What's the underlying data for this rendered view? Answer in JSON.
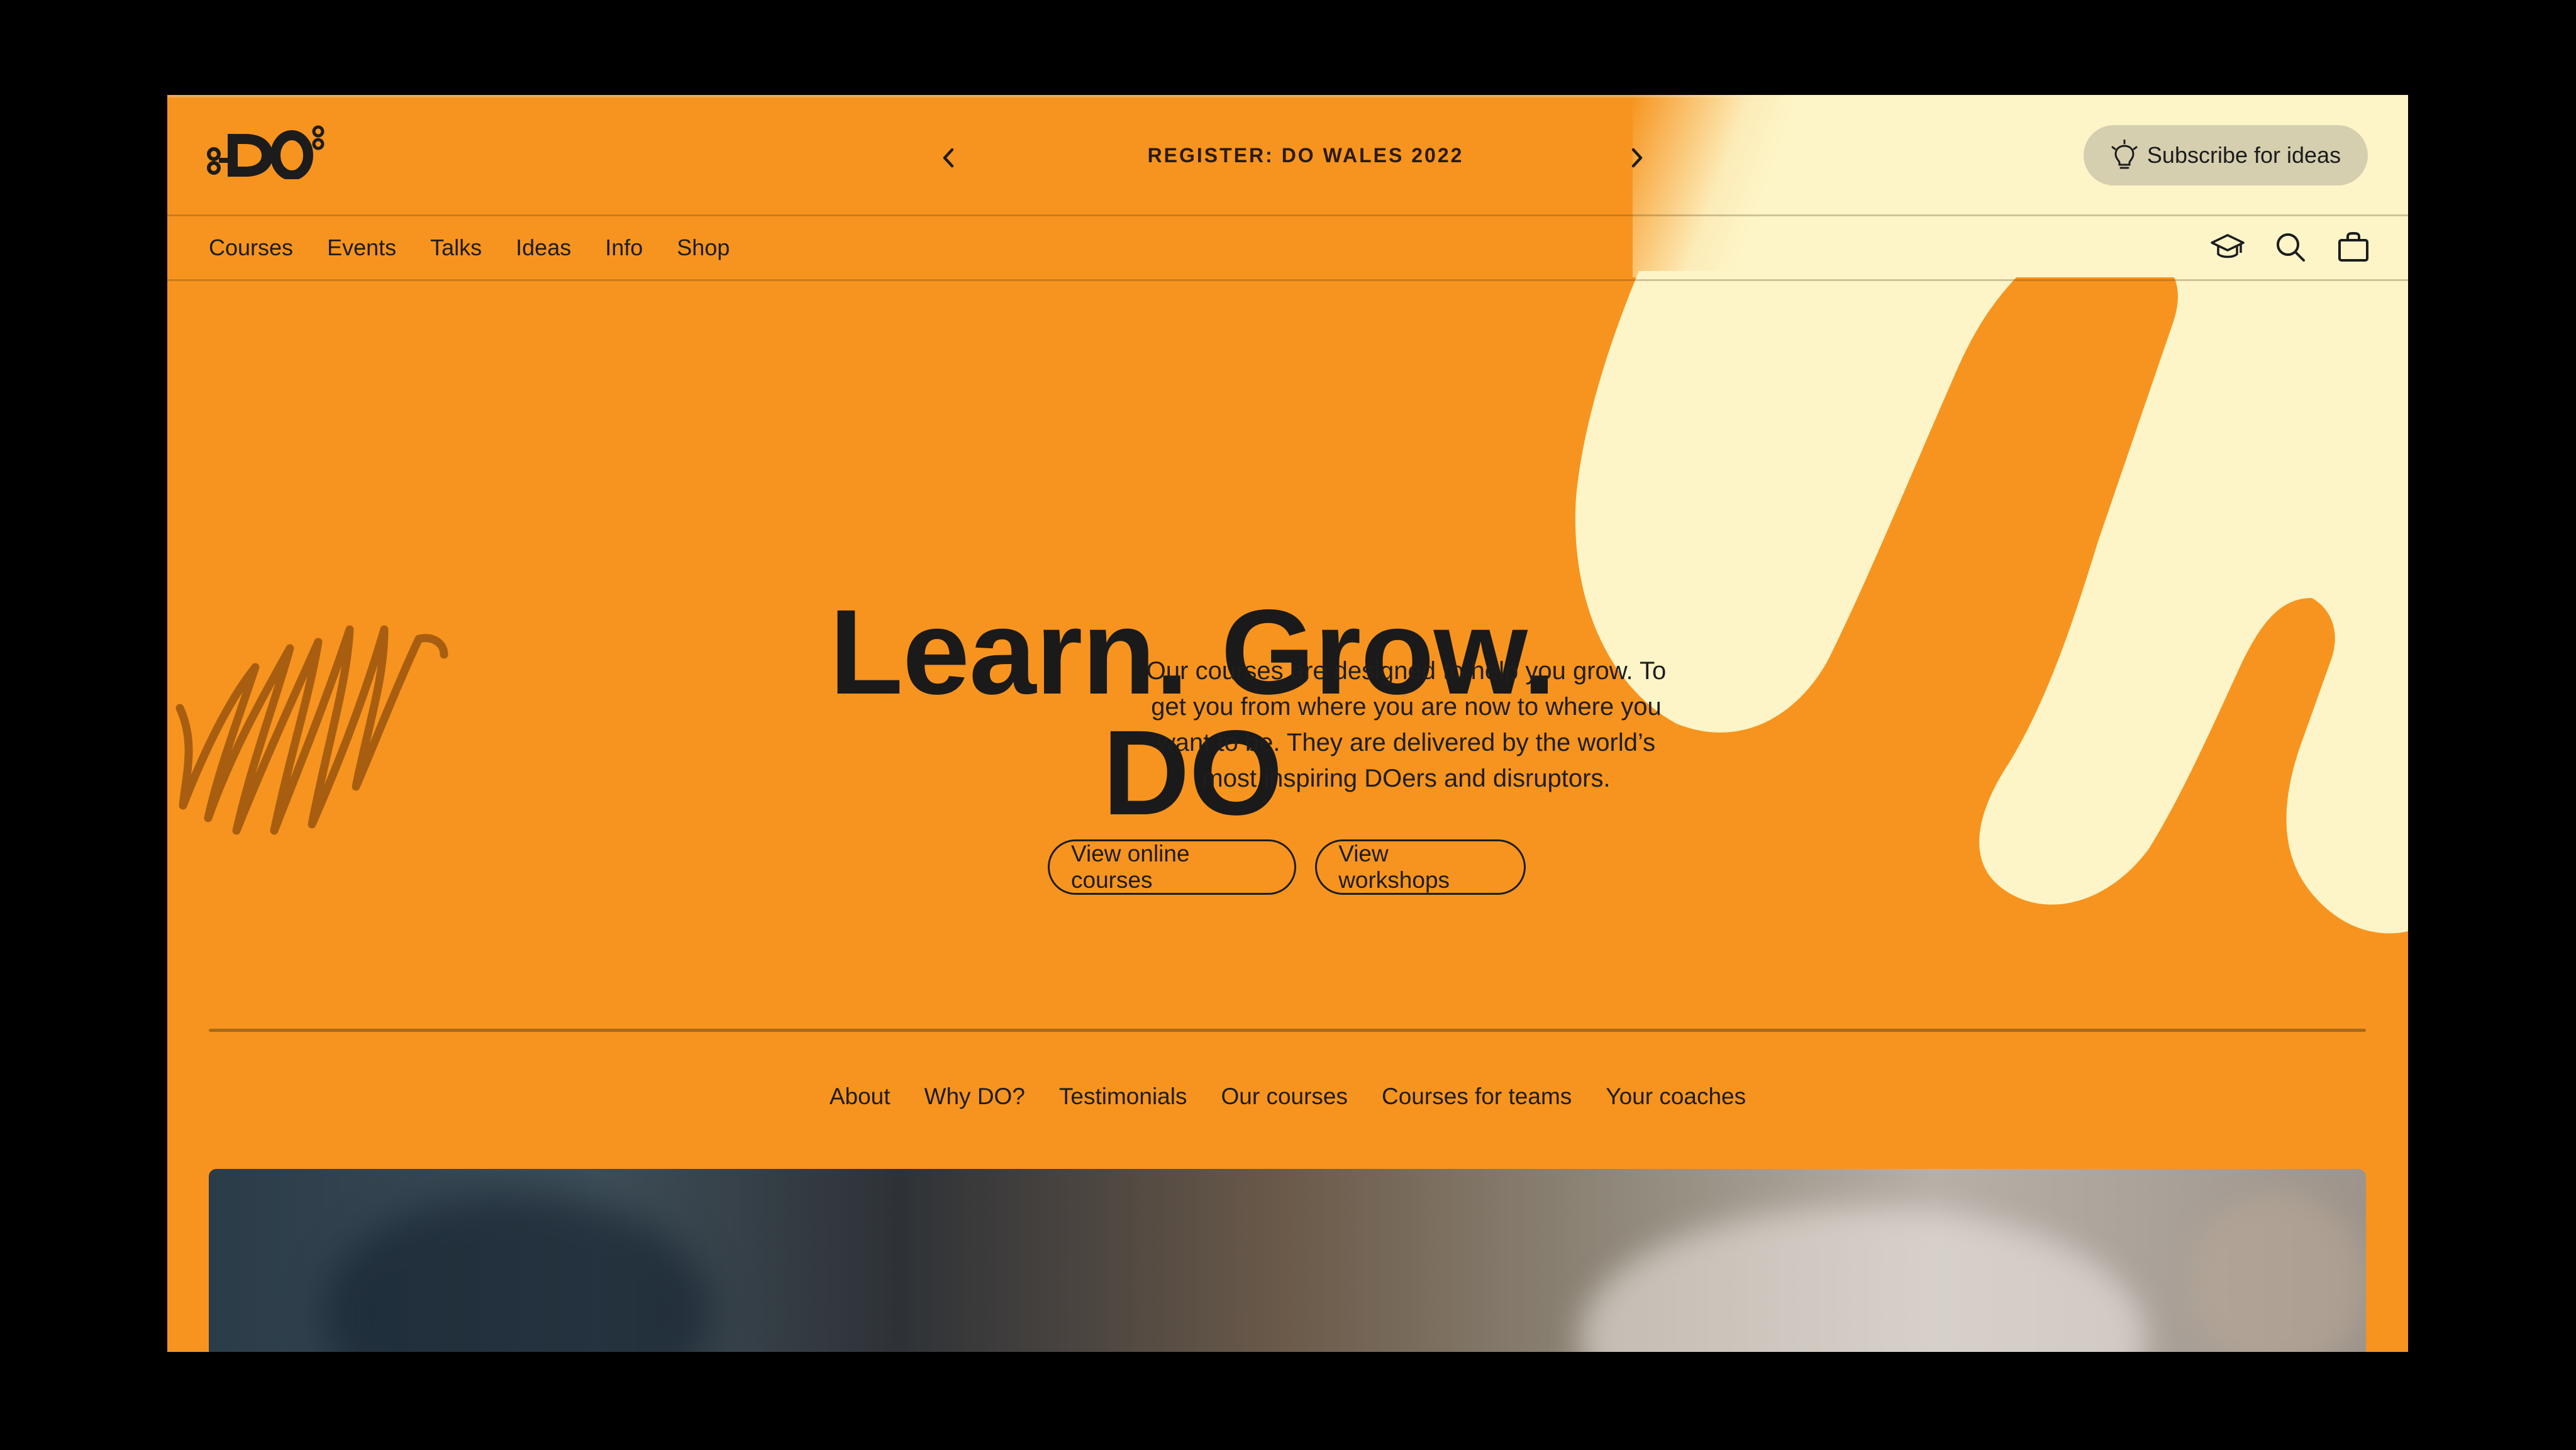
{
  "header": {
    "logo_text": "DO",
    "announcement": "REGISTER: DO WALES 2022",
    "prev_icon": "chevron-left-icon",
    "next_icon": "chevron-right-icon",
    "subscribe_label": "Subscribe for ideas",
    "subscribe_icon": "lightbulb-icon"
  },
  "nav": {
    "items": [
      "Courses",
      "Events",
      "Talks",
      "Ideas",
      "Info",
      "Shop"
    ],
    "icons": [
      "graduation-cap-icon",
      "search-icon",
      "bag-icon"
    ]
  },
  "hero": {
    "title": "Learn. Grow. DO",
    "description": "Our courses are designed to help you grow. To get you from where you are now to where you want to be. They are delivered by the world’s most inspiring DOers and disruptors.",
    "buttons": [
      "View online courses",
      "View workshops"
    ]
  },
  "subnav": {
    "items": [
      "About",
      "Why DO?",
      "Testimonials",
      "Our courses",
      "Courses for teams",
      "Your coaches"
    ]
  },
  "colors": {
    "background": "#F7941F",
    "cream": "#FDF5C8",
    "text": "#1C1C1C",
    "scribble": "#A85E10"
  }
}
